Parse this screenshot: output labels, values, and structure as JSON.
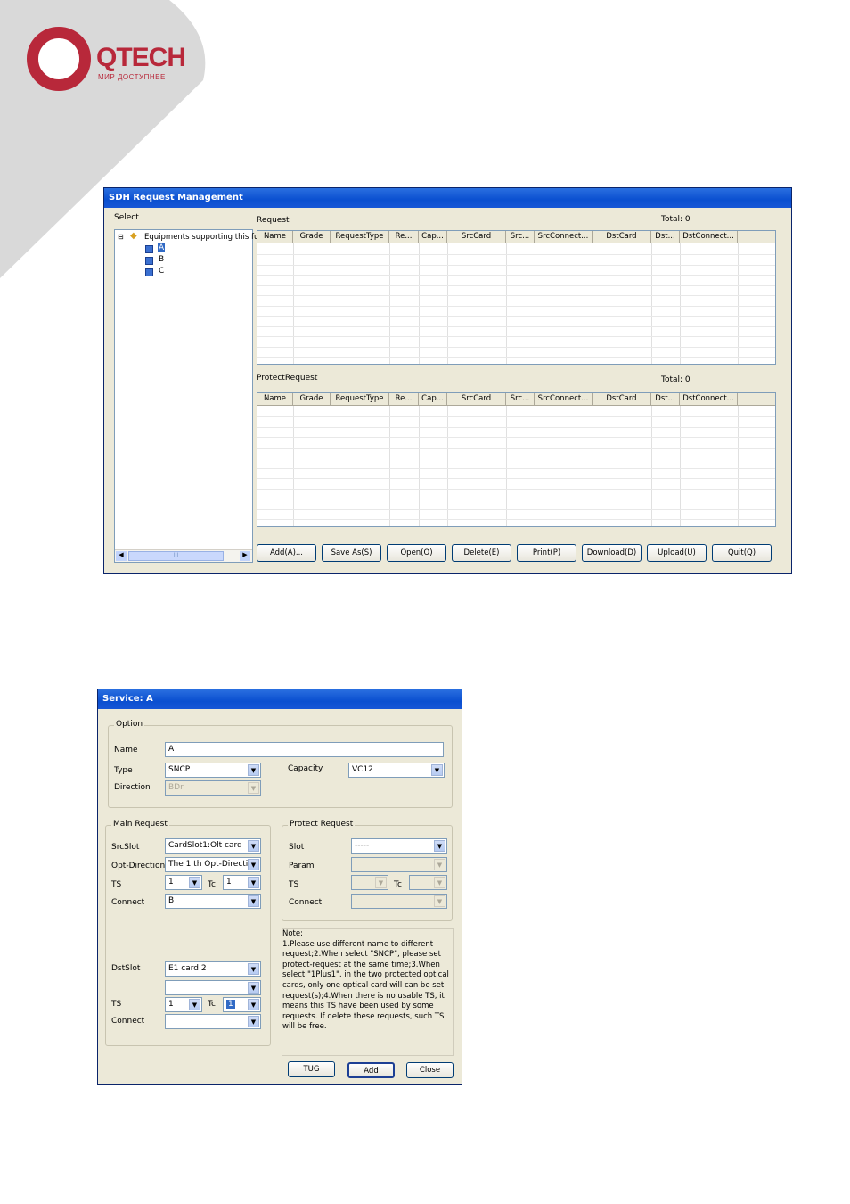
{
  "logo": {
    "brand": "QTECH",
    "tagline": "МИР ДОСТУПНЕЕ"
  },
  "sdh": {
    "title": "SDH Request Management",
    "select_label": "Select",
    "tree": {
      "root": "Equipments supporting this fun",
      "items": [
        "A",
        "B",
        "C"
      ]
    },
    "request_label": "Request",
    "request_total": "Total: 0",
    "protect_label": "ProtectRequest",
    "protect_total": "Total: 0",
    "columns": [
      "Name",
      "Grade",
      "RequestType",
      "Re...",
      "Cap...",
      "SrcCard",
      "Src...",
      "SrcConnect...",
      "DstCard",
      "Dst...",
      "DstConnect..."
    ],
    "scroll_thumb": "III",
    "buttons": [
      "Add(A)...",
      "Save As(S)",
      "Open(O)",
      "Delete(E)",
      "Print(P)",
      "Download(D)",
      "Upload(U)",
      "Quit(Q)"
    ]
  },
  "service": {
    "title": "Service:  A",
    "option_group": "Option",
    "name_label": "Name",
    "name_value": "A",
    "type_label": "Type",
    "type_value": "SNCP",
    "capacity_label": "Capacity",
    "capacity_value": "VC12",
    "direction_label": "Direction",
    "direction_value": "BDr",
    "main_group": "Main Request",
    "srcslot_label": "SrcSlot",
    "srcslot_value": "CardSlot1:Olt card",
    "optdir_label": "Opt-Direction",
    "optdir_value": "The 1 th Opt-Directi",
    "ts_label": "TS",
    "ts_value": "1",
    "tc_label": "Tc",
    "tc_value": "1",
    "connect_label": "Connect",
    "connect_value": "B",
    "dstslot_label": "DstSlot",
    "dstslot_value": "E1 card 2",
    "dst_extra_value": "",
    "dst_ts_label": "TS",
    "dst_ts_value": "1",
    "dst_tc_label": "Tc",
    "dst_tc_value": "1",
    "dst_connect_label": "Connect",
    "dst_connect_value": "",
    "protect_group": "Protect Request",
    "slot_label": "Slot",
    "slot_value": "-----",
    "param_label": "Param",
    "p_ts_label": "TS",
    "p_tc_label": "Tc",
    "p_connect_label": "Connect",
    "note_lines": [
      "Note:",
      "1.Please use different name to different",
      "request;2.When select \"SNCP\", please set",
      "protect-request at the same time;3.When",
      "select \"1Plus1\", in the two protected optical",
      "cards, only one optical card will can be set",
      "request(s);4.When there is no usable TS, it",
      "means this TS have been used by some",
      "requests. If delete these requests, such TS",
      "will be free."
    ],
    "buttons": {
      "tug": "TUG",
      "add": "Add",
      "close": "Close"
    }
  }
}
